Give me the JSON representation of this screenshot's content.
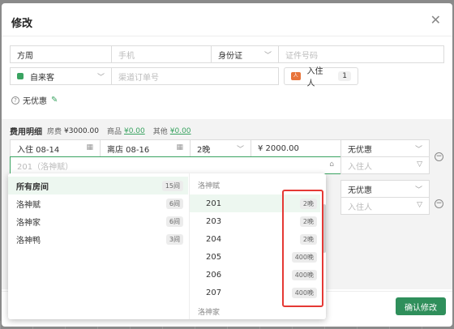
{
  "modal": {
    "title": "修改"
  },
  "guest_row": {
    "name": "方周",
    "phone_placeholder": "手机",
    "id_type": "身份证",
    "id_placeholder": "证件号码"
  },
  "source_row": {
    "channel": "自来客",
    "order_placeholder": "渠道订单号",
    "checkin_label": "入住人",
    "checkin_count": "1"
  },
  "promo": {
    "label": "无优惠"
  },
  "fees": {
    "title": "费用明细",
    "room_label": "房费",
    "room_amount": "¥3000.00",
    "goods_label": "商品",
    "goods_amount": "¥0.00",
    "other_label": "其他",
    "other_amount": "¥0.00"
  },
  "line1": {
    "checkin": "入住 08-14",
    "checkout": "离店 08-16",
    "nights": "2晚",
    "price": "¥ 2000.00",
    "promo": "无优惠",
    "room_input": "201（洛神赋）",
    "guest_placeholder": "入住人"
  },
  "line2": {
    "promo": "无优惠",
    "guest_placeholder": "入住人"
  },
  "dropdown": {
    "left": [
      {
        "label": "所有房间",
        "count": "15间"
      },
      {
        "label": "洛神赋",
        "count": "6间"
      },
      {
        "label": "洛神家",
        "count": "6间"
      },
      {
        "label": "洛神鸭",
        "count": "3间"
      }
    ],
    "group1": "洛神赋",
    "rooms": [
      {
        "label": "201",
        "badge": "2晚"
      },
      {
        "label": "203",
        "badge": "2晚"
      },
      {
        "label": "204",
        "badge": "2晚"
      },
      {
        "label": "205",
        "badge": "400晚"
      },
      {
        "label": "206",
        "badge": "400晚"
      },
      {
        "label": "207",
        "badge": "400晚"
      }
    ],
    "group2": "洛神家"
  },
  "footer": {
    "confirm": "确认修改"
  },
  "colors": {
    "accent": "#2f8f5b",
    "highlight": "#e53935"
  }
}
